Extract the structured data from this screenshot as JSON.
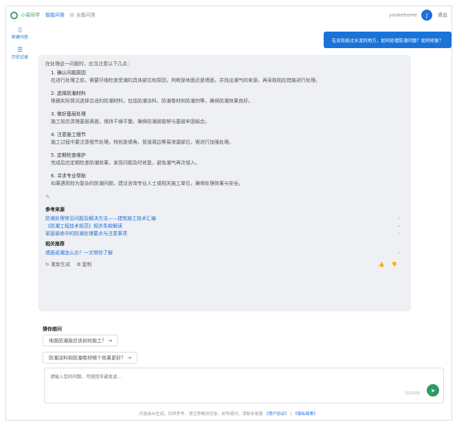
{
  "topbar": {
    "brand": "小易同学",
    "nav": "智能问答",
    "tool": "全能问答",
    "user_name": "youkehome",
    "avatar_glyph": "J",
    "action": "退出",
    "colors": {
      "brand": "#3aa06a",
      "accent": "#1e6fd9"
    }
  },
  "sidebar": {
    "items": [
      {
        "icon": "document-icon",
        "label": "新建问答"
      },
      {
        "icon": "list-icon",
        "label": "历史记录"
      }
    ]
  },
  "primary_button": "在没有经过水泥的地方，如何处理防潮问题？如何修复？",
  "answer": {
    "intro": "在处理这一问题时，应当注意以下几点：",
    "sections": [
      {
        "head": "1. 确认问题原因",
        "body": "在进行处理之前，需要仔细检查受潮的具体部位和原因，判断是地面还是墙面，并找出潮气的来源，再采取相应措施进行处理。"
      },
      {
        "head": "2. 选择防潮材料",
        "body": "根据实际情况选择合适的防潮材料，包括防潮涂料、防潮卷材和防潮剂等，确保防潮效果良好。"
      },
      {
        "head": "3. 做好基层处理",
        "body": "施工前应清理基层表面，保持干燥平整，确保防潮层能够与基层牢固结合。"
      },
      {
        "head": "4. 注意施工细节",
        "body": "施工过程中要注意细节处理，特别是墙角、管道周边等易渗漏部位，需进行加强处理。"
      },
      {
        "head": "5. 定期检查维护",
        "body": "完成后应定期检查防潮效果，发现问题及时修复，避免潮气再次侵入。"
      },
      {
        "head": "6. 寻求专业帮助",
        "body": "如果遇到较为复杂的防潮问题，建议咨询专业人士或相关施工单位，确保处理效果与安全。"
      }
    ],
    "refs_title": "参考来源",
    "refs": [
      "防潮处理常见问题及解决方法——建筑施工技术汇编",
      "《防潮工程技术规范》相关条款解读",
      "家庭装修中的防潮处理要点与注意事项"
    ],
    "related_title": "相关推荐",
    "related": [
      "墙面返潮怎么办？一文带你了解"
    ],
    "footer_actions": [
      "重新生成",
      "复制"
    ]
  },
  "follow_up": {
    "title": "猜你想问",
    "chips": [
      "地面防潮层应该如何施工？",
      "防潮涂料和防潮卷材哪个效果更好？"
    ]
  },
  "input": {
    "placeholder": "请输入您的问题，可按回车键发送…",
    "counter": "0/1000"
  },
  "footer": {
    "text": "内容由AI生成，仅供参考，请注意甄别信息。如有疑问，请联系客服",
    "link1": "《用户协议》",
    "link2": "《隐私政策》"
  }
}
